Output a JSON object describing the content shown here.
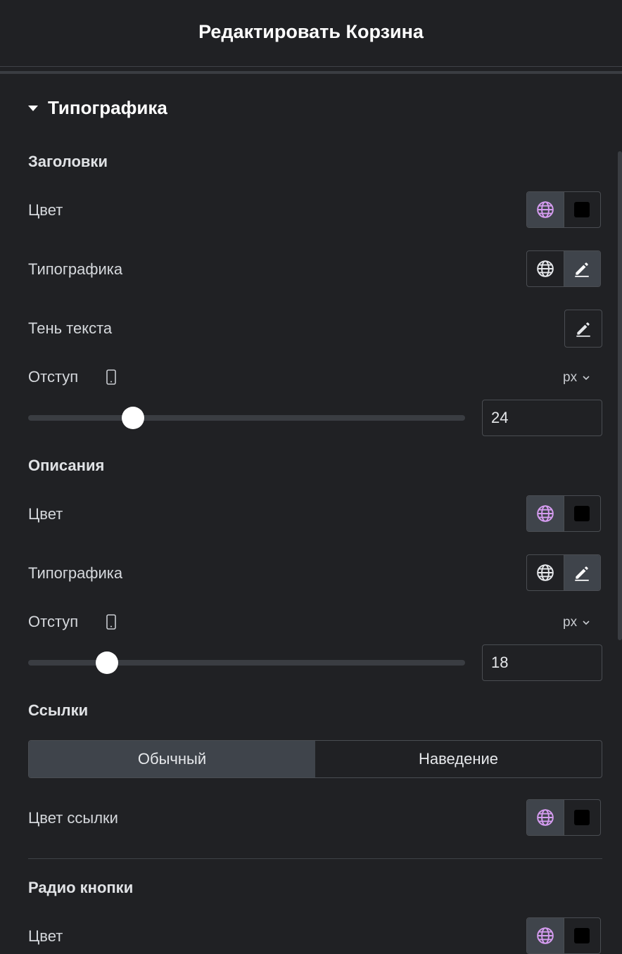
{
  "header": {
    "title": "Редактировать Корзина"
  },
  "section": {
    "title": "Типографика"
  },
  "headings_group": {
    "title": "Заголовки",
    "color_label": "Цвет",
    "typography_label": "Типографика",
    "text_shadow_label": "Тень текста",
    "spacing_label": "Отступ",
    "unit": "px",
    "spacing_value": "24",
    "spacing_fraction": 0.24
  },
  "descriptions_group": {
    "title": "Описания",
    "color_label": "Цвет",
    "typography_label": "Типографика",
    "spacing_label": "Отступ",
    "unit": "px",
    "spacing_value": "18",
    "spacing_fraction": 0.18
  },
  "links_group": {
    "title": "Ссылки",
    "tabs": [
      "Обычный",
      "Наведение"
    ],
    "active_tab": 0,
    "link_color_label": "Цвет ссылки"
  },
  "radio_group": {
    "title": "Радио кнопки",
    "color_label": "Цвет"
  },
  "colors": {
    "global_icon_active": "#d59cf0",
    "swatch": "#000000"
  },
  "icons": {
    "global": "globe-icon",
    "edit": "pencil-icon",
    "device": "mobile-device-icon",
    "dropdown": "chevron-down-icon",
    "section_toggle": "caret-down-icon"
  }
}
